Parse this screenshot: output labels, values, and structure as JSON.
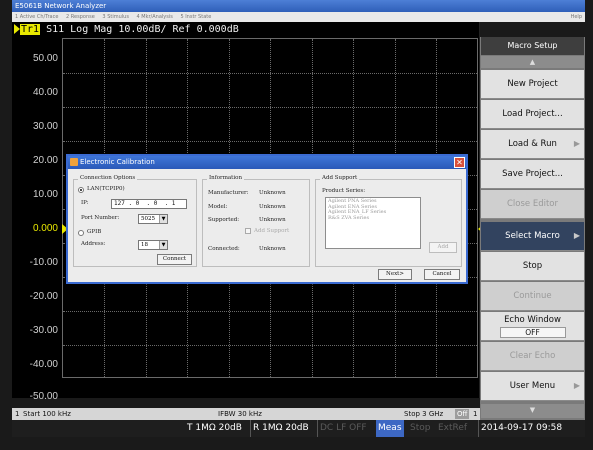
{
  "window": {
    "title": "E5061B Network Analyzer"
  },
  "menu": {
    "items": [
      "1 Active Ch/Trace",
      "2 Response",
      "3 Stimulus",
      "4 Mkr/Analysis",
      "5 Instr State"
    ],
    "help": "Help"
  },
  "trace_header": {
    "trace": "Tr1",
    "rest": " S11 Log Mag 10.00dB/ Ref 0.000dB"
  },
  "y_axis": [
    "50.00",
    "40.00",
    "30.00",
    "20.00",
    "10.00",
    "0.000",
    "-10.00",
    "-20.00",
    "-30.00",
    "-40.00",
    "-50.00"
  ],
  "status": {
    "channel": "1",
    "start": "Start 100 kHz",
    "ifbw": "IFBW 30 kHz",
    "stop": "Stop 3 GHz",
    "off": "Off",
    "right": "1"
  },
  "bottom": {
    "t": "T 1MΩ 20dB",
    "r": "R 1MΩ 20dB",
    "dc": "DC LF OFF",
    "meas": "Meas",
    "stop": "Stop",
    "extref": "ExtRef",
    "datetime": "2014-09-17 09:58"
  },
  "softkeys": {
    "title": "Macro Setup",
    "up": "▲",
    "down": "▼",
    "new_project": "New Project",
    "load_project": "Load Project...",
    "load_run": "Load & Run",
    "save_project": "Save Project...",
    "close_editor": "Close Editor",
    "select_macro": "Select Macro",
    "stop": "Stop",
    "continue": "Continue",
    "echo_window": "Echo Window",
    "echo_value": "OFF",
    "clear_echo": "Clear Echo",
    "user_menu": "User Menu",
    "chevron": "▶"
  },
  "dialog": {
    "title": "Electronic Calibration",
    "close": "✕",
    "connection": {
      "title": "Connection Options",
      "lan_label": "LAN(TCPIP0)",
      "ip_label": "IP:",
      "ip_value": "127 . 0  . 0  . 1",
      "port_label": "Port Number:",
      "port_value": "5025",
      "gpib_label": "GPIB",
      "address_label": "Address:",
      "address_value": "18",
      "connect": "Connect"
    },
    "information": {
      "title": "Information",
      "manufacturer_label": "Manufacturer:",
      "manufacturer_value": "Unknown",
      "model_label": "Model:",
      "model_value": "Unknown",
      "supported_label": "Supported:",
      "supported_value": "Unknown",
      "add_support": "Add Support",
      "connected_label": "Connected:",
      "connected_value": "Unknown"
    },
    "add_support": {
      "title": "Add Support",
      "series_label": "Product Series:",
      "series": [
        "Agilent PNA Series",
        "Agilent ENA Series",
        "Agilent ENA_LF Series",
        "R&S ZVA Series"
      ],
      "add": "Add"
    },
    "next": "Next>",
    "cancel": "Cancel"
  },
  "colors": {
    "trace_yellow": "#e8e800",
    "title_blue": "#3f76d8",
    "selected_key": "#32435f"
  }
}
